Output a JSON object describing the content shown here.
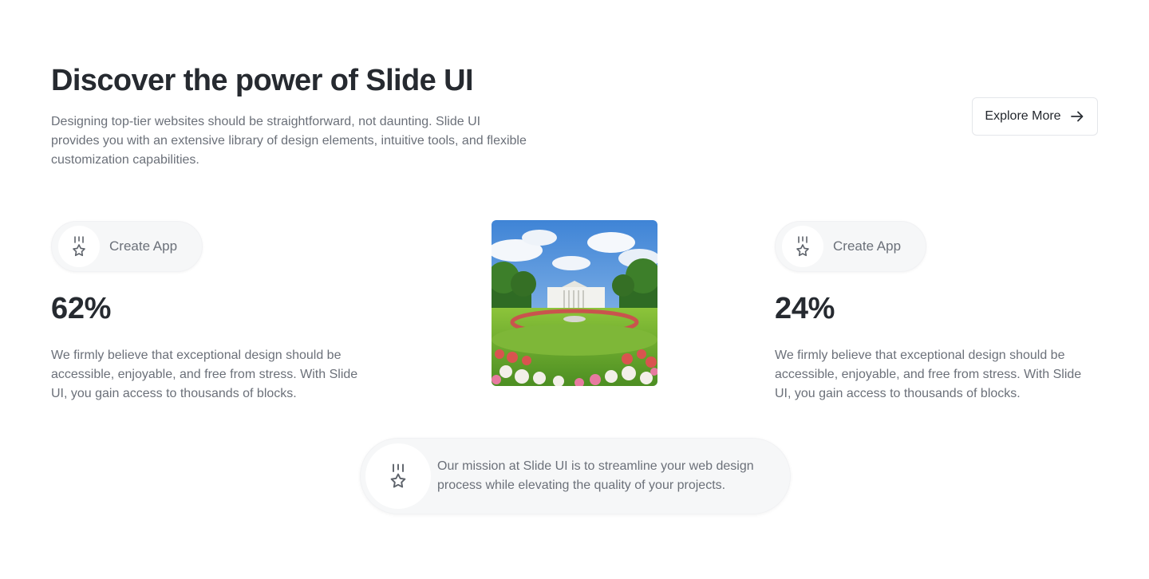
{
  "hero": {
    "title": "Discover the power of Slide UI",
    "description": "Designing top-tier websites should be straightforward, not daunting. Slide UI provides you with an extensive library of design elements, intuitive tools, and flexible customization capabilities.",
    "cta_label": "Explore More",
    "cta_icon": "arrow-right-icon"
  },
  "features": [
    {
      "label": "Create App",
      "icon": "medal-star-icon",
      "stat": "62%",
      "description": "We firmly believe that exceptional design should be accessible, enjoyable, and free from stress. With Slide UI, you gain access to thousands of blocks."
    },
    {
      "label": "Create App",
      "icon": "medal-star-icon",
      "stat": "24%",
      "description": "We firmly believe that exceptional design should be accessible, enjoyable, and free from stress. With Slide UI, you gain access to thousands of blocks."
    }
  ],
  "mission": {
    "icon": "medal-star-icon",
    "text": "Our mission at Slide UI is to streamline your web design process while elevating the quality of your projects."
  },
  "colors": {
    "heading": "#262a30",
    "body_text": "#6b7079",
    "pill_background": "#f6f7f8",
    "border": "#e4e6ea"
  }
}
